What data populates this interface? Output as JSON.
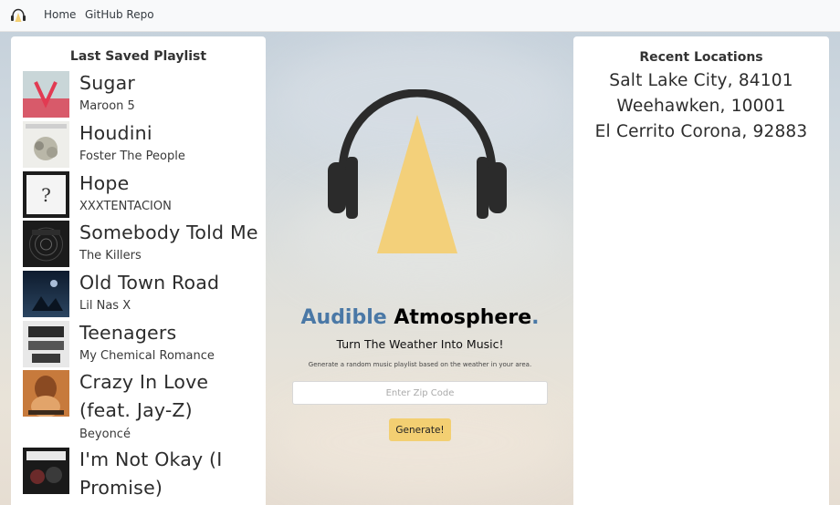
{
  "nav": {
    "brand_icon": "headphones-logo-icon",
    "links": [
      "Home",
      "GitHub Repo"
    ]
  },
  "playlist": {
    "title": "Last Saved Playlist",
    "tracks": [
      {
        "title": "Sugar",
        "artist": "Maroon 5",
        "art": "album-art-sugar"
      },
      {
        "title": "Houdini",
        "artist": "Foster The People",
        "art": "album-art-houdini"
      },
      {
        "title": "Hope",
        "artist": "XXXTENTACION",
        "art": "album-art-hope"
      },
      {
        "title": "Somebody Told Me",
        "artist": "The Killers",
        "art": "album-art-killers"
      },
      {
        "title": "Old Town Road",
        "artist": "Lil Nas X",
        "art": "album-art-old-town-road"
      },
      {
        "title": "Teenagers",
        "artist": "My Chemical Romance",
        "art": "album-art-teenagers"
      },
      {
        "title": "Crazy In Love (feat. Jay-Z)",
        "artist": "Beyoncé",
        "art": "album-art-crazy-in-love"
      },
      {
        "title": "I'm Not Okay (I Promise)",
        "artist": "",
        "art": "album-art-im-not-okay"
      }
    ]
  },
  "hero": {
    "title_part1": "Audible",
    "title_part2": " Atmosphere",
    "title_part3": ".",
    "tagline": "Turn The Weather Into Music!",
    "description": "Generate a random music playlist based on the weather in your area.",
    "zip_placeholder": "Enter Zip Code",
    "zip_value": "",
    "generate_label": "Generate!"
  },
  "locations": {
    "title": "Recent Locations",
    "items": [
      "Salt Lake City, 84101",
      "Weehawken, 10001",
      "El Cerrito Corona, 92883"
    ]
  },
  "colors": {
    "accent_blue": "#4a78a6",
    "brand_yellow": "#f3cf72",
    "headphone_dark": "#2b2b2b"
  }
}
